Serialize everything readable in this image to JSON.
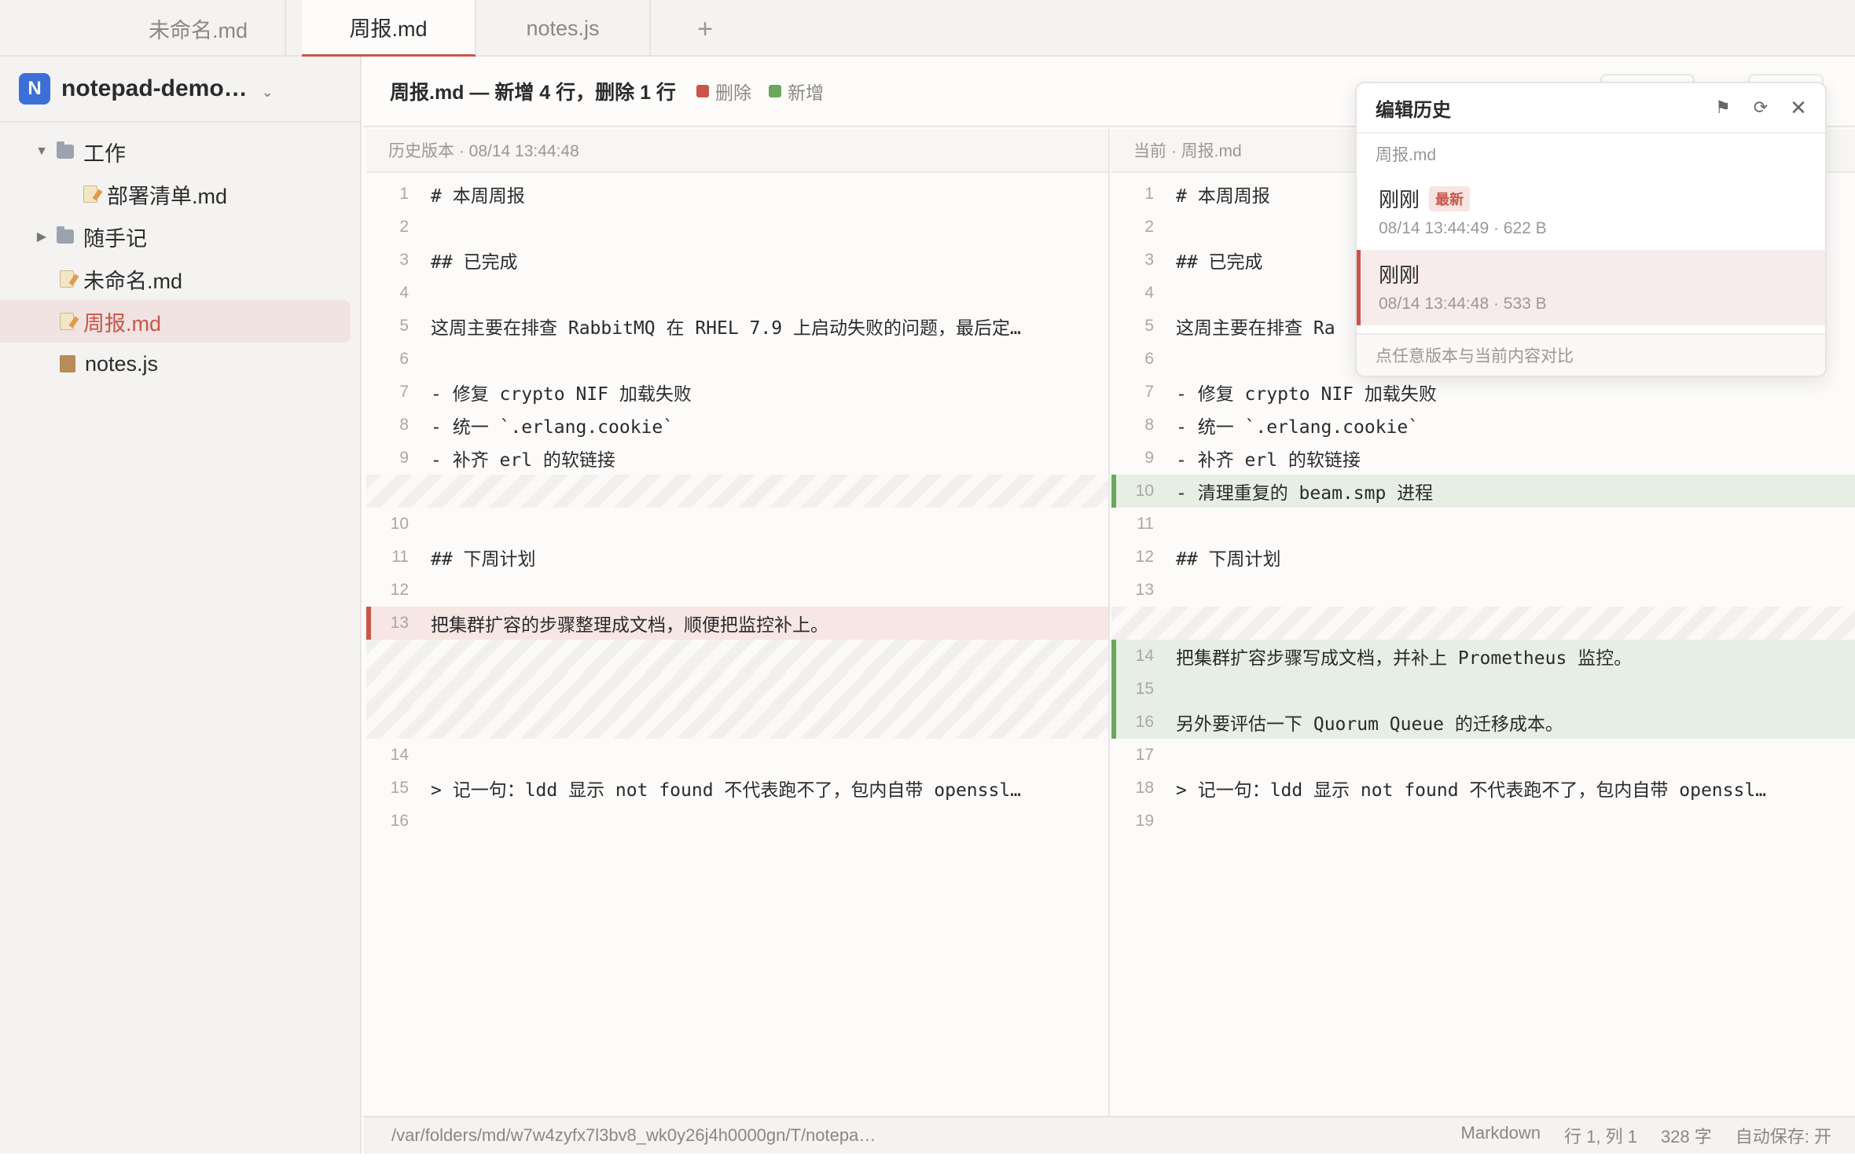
{
  "tabs": [
    {
      "label": "未命名.md"
    },
    {
      "label": "周报.md"
    },
    {
      "label": "notes.js"
    }
  ],
  "tab_add": "+",
  "workspace": {
    "badge": "N",
    "name": "notepad-demo…",
    "chevron": "⌄"
  },
  "tree": [
    {
      "label": "工作",
      "kind": "folder"
    },
    {
      "label": "部署清单.md",
      "kind": "md"
    },
    {
      "label": "随手记",
      "kind": "folder"
    },
    {
      "label": "未命名.md",
      "kind": "md"
    },
    {
      "label": "周报.md",
      "kind": "md"
    },
    {
      "label": "notes.js",
      "kind": "js"
    }
  ],
  "diff": {
    "title": "周报.md — 新增 4 行，删除 1 行",
    "legend_deleted": "删除",
    "legend_added": "新增",
    "color_deleted": "#c8564a",
    "color_added": "#6aa85b",
    "left_header": "历史版本 · 08/14 13:44:48",
    "right_header": "当前 · 周报.md",
    "left": [
      {
        "n": "1",
        "t": "# 本周周报"
      },
      {
        "n": "2",
        "t": ""
      },
      {
        "n": "3",
        "t": "## 已完成"
      },
      {
        "n": "4",
        "t": ""
      },
      {
        "n": "5",
        "t": "这周主要在排查 RabbitMQ 在 RHEL 7.9 上启动失败的问题，最后定…"
      },
      {
        "n": "6",
        "t": ""
      },
      {
        "n": "7",
        "t": "- 修复 crypto NIF 加载失败"
      },
      {
        "n": "8",
        "t": "- 统一 `.erlang.cookie`"
      },
      {
        "n": "9",
        "t": "- 补齐 erl 的软链接"
      },
      {
        "n": "",
        "t": ""
      },
      {
        "n": "10",
        "t": ""
      },
      {
        "n": "11",
        "t": "## 下周计划"
      },
      {
        "n": "12",
        "t": ""
      },
      {
        "n": "13",
        "t": "把集群扩容的步骤整理成文档，顺便把监控补上。"
      },
      {
        "n": "",
        "t": ""
      },
      {
        "n": "",
        "t": ""
      },
      {
        "n": "",
        "t": ""
      },
      {
        "n": "14",
        "t": ""
      },
      {
        "n": "15",
        "t": "> 记一句：ldd 显示 not found 不代表跑不了，包内自带 openssl…"
      },
      {
        "n": "16",
        "t": ""
      }
    ],
    "right": [
      {
        "n": "1",
        "t": "# 本周周报"
      },
      {
        "n": "2",
        "t": ""
      },
      {
        "n": "3",
        "t": "## 已完成"
      },
      {
        "n": "4",
        "t": ""
      },
      {
        "n": "5",
        "t": "这周主要在排查 Ra"
      },
      {
        "n": "6",
        "t": ""
      },
      {
        "n": "7",
        "t": "- 修复 crypto NIF 加载失败"
      },
      {
        "n": "8",
        "t": "- 统一 `.erlang.cookie`"
      },
      {
        "n": "9",
        "t": "- 补齐 erl 的软链接"
      },
      {
        "n": "10",
        "t": "- 清理重复的 beam.smp 进程"
      },
      {
        "n": "11",
        "t": ""
      },
      {
        "n": "12",
        "t": "## 下周计划"
      },
      {
        "n": "13",
        "t": ""
      },
      {
        "n": "",
        "t": ""
      },
      {
        "n": "14",
        "t": "把集群扩容步骤写成文档，并补上 Prometheus 监控。"
      },
      {
        "n": "15",
        "t": ""
      },
      {
        "n": "16",
        "t": "另外要评估一下 Quorum Queue 的迁移成本。"
      },
      {
        "n": "17",
        "t": ""
      },
      {
        "n": "18",
        "t": "> 记一句：ldd 显示 not found 不代表跑不了，包内自带 openssl…"
      },
      {
        "n": "19",
        "t": ""
      }
    ]
  },
  "history": {
    "title": "编辑历史",
    "file": "周报.md",
    "icon_flag": "⚑",
    "icon_refresh": "⟳",
    "icon_close": "✕",
    "versions": [
      {
        "name": "刚刚",
        "badge": "最新",
        "meta": "08/14 13:44:49 · 622 B"
      },
      {
        "name": "刚刚",
        "badge": "",
        "meta": "08/14 13:44:48 · 533 B"
      }
    ],
    "footer": "点任意版本与当前内容对比"
  },
  "status": {
    "path": "/var/folders/md/w7w4zyfx7l3bv8_wk0y26j4h0000gn/T/notepa…",
    "language": "Markdown",
    "position": "行 1, 列 1",
    "chars": "328 字",
    "autosave": "自动保存: 开"
  }
}
